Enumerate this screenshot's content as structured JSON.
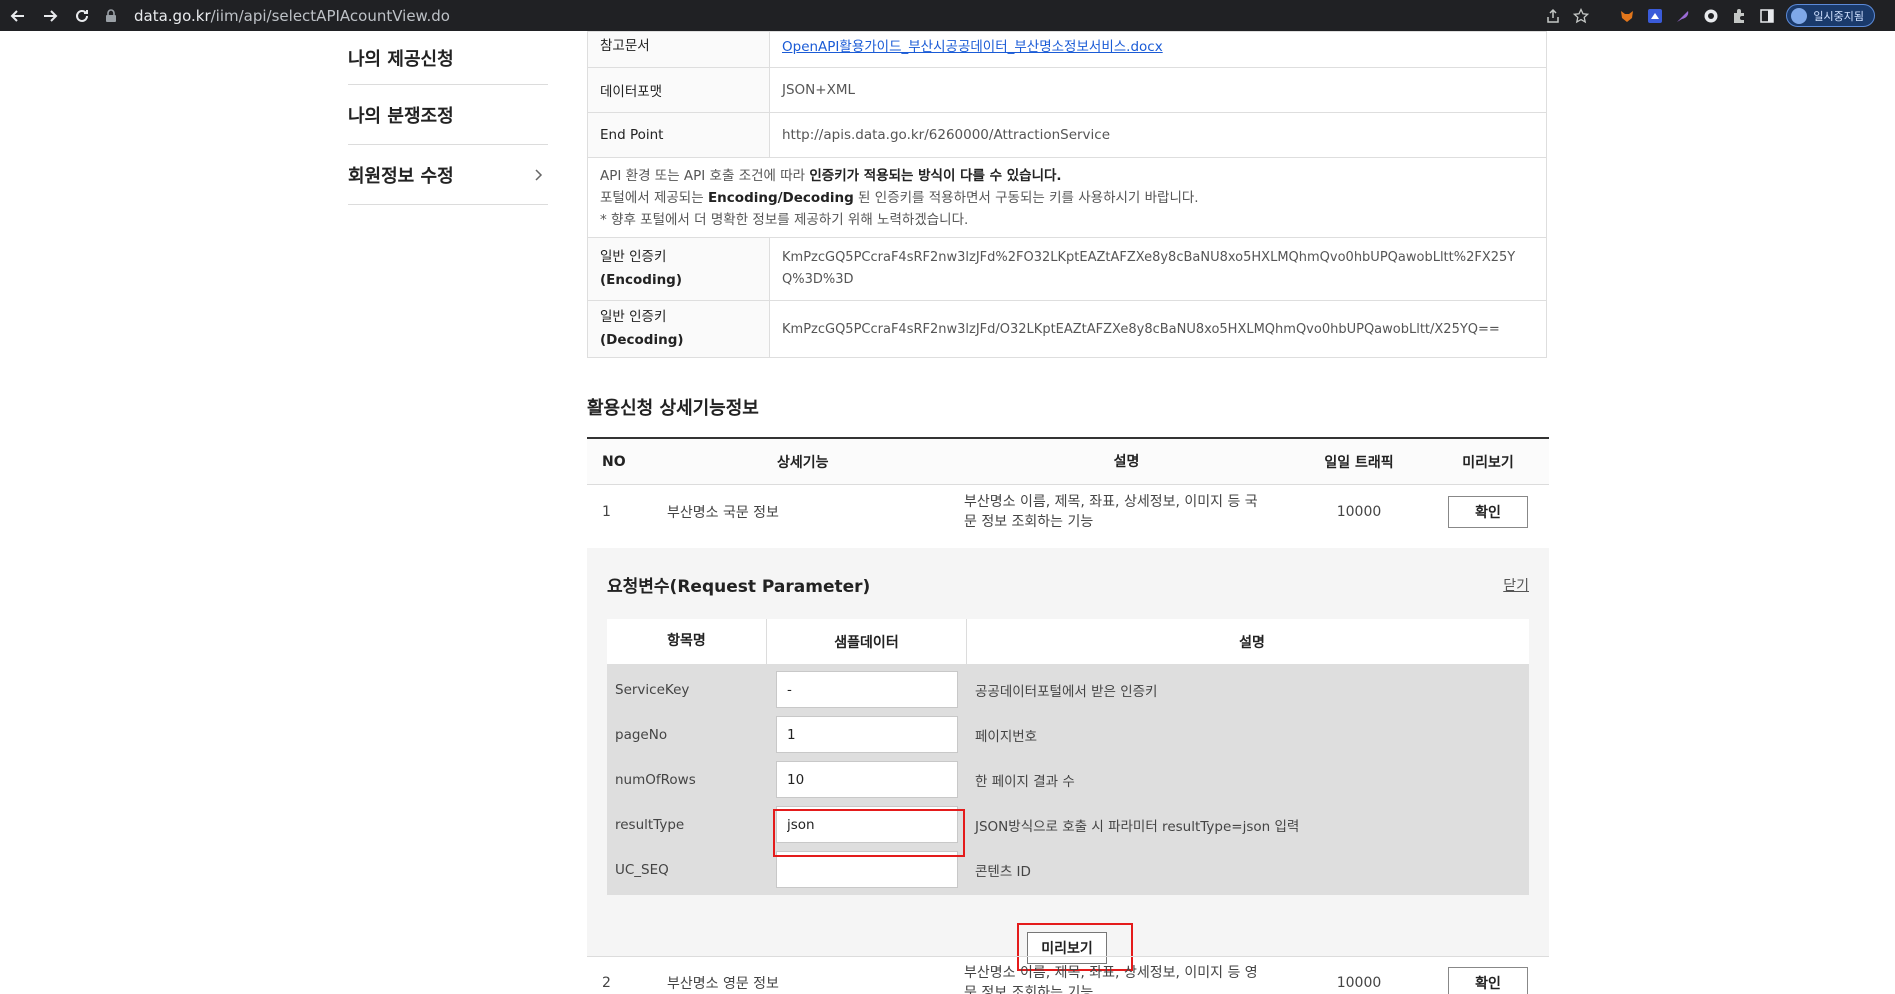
{
  "browser": {
    "url_host": "data.go.kr",
    "url_path": "/iim/api/selectAPIAcountView.do",
    "profile_label": "일시중지됨"
  },
  "sidebar": {
    "items": [
      {
        "label": "나의 제공신청"
      },
      {
        "label": "나의 분쟁조정"
      },
      {
        "label": "회원정보 수정"
      }
    ]
  },
  "info": {
    "ref_doc_label": "참고문서",
    "ref_doc_value": "OpenAPI활용가이드_부산시공공데이터_부산명소정보서비스.docx",
    "format_label": "데이터포맷",
    "format_value": "JSON+XML",
    "endpoint_label": "End Point",
    "endpoint_value": "http://apis.data.go.kr/6260000/AttractionService",
    "notice_line1_a": "API 환경 또는 API 호출 조건에 따라 ",
    "notice_line1_b": "인증키가 적용되는 방식이 다를 수 있습니다.",
    "notice_line2_a": "포털에서 제공되는 ",
    "notice_line2_b": "Encoding/Decoding",
    "notice_line2_c": " 된 인증키를 적용하면서 구동되는 키를 사용하시기 바랍니다.",
    "notice_line3": "* 향후 포털에서 더 명확한 정보를 제공하기 위해 노력하겠습니다.",
    "enc_label_1": "일반 인증키",
    "enc_label_2": "(Encoding)",
    "enc_value": "KmPzcGQ5PCcraF4sRF2nw3lzJFd%2FO32LKptEAZtAFZXe8y8cBaNU8xo5HXLMQhmQvo0hbUPQawobLltt%2FX25YQ%3D%3D",
    "dec_label_1": "일반 인증키",
    "dec_label_2": "(Decoding)",
    "dec_value": "KmPzcGQ5PCcraF4sRF2nw3lzJFd/O32LKptEAZtAFZXe8y8cBaNU8xo5HXLMQhmQvo0hbUPQawobLltt/X25YQ=="
  },
  "section_title": "활용신청 상세기능정보",
  "func_table": {
    "headers": {
      "no": "NO",
      "name": "상세기능",
      "desc": "설명",
      "traffic": "일일 트래픽",
      "preview": "미리보기"
    },
    "rows": [
      {
        "no": "1",
        "name": "부산명소 국문 정보",
        "desc_1": "부산명소 이름, 제목, 좌표, 상세정보, 이미지 등 국",
        "desc_2": "문 정보 조회하는 기능",
        "traffic": "10000",
        "button": "확인"
      },
      {
        "no": "2",
        "name": "부산명소 영문 정보",
        "desc_1": "부산명소 이름, 제목, 좌표, 상세정보, 이미지 등 영",
        "desc_2": "문 정보 조회하는 기능",
        "traffic": "10000",
        "button": "확인"
      }
    ]
  },
  "request": {
    "title": "요청변수(Request Parameter)",
    "close_label": "닫기",
    "headers": {
      "name": "항목명",
      "sample": "샘플데이터",
      "desc": "설명"
    },
    "params": [
      {
        "name": "ServiceKey",
        "value": "-",
        "desc": "공공데이터포털에서 받은 인증키"
      },
      {
        "name": "pageNo",
        "value": "1",
        "desc": "페이지번호"
      },
      {
        "name": "numOfRows",
        "value": "10",
        "desc": "한 페이지 결과 수"
      },
      {
        "name": "resultType",
        "value": "json",
        "desc": "JSON방식으로 호출 시 파라미터 resultType=json 입력"
      },
      {
        "name": "UC_SEQ",
        "value": "",
        "desc": "콘텐츠 ID"
      }
    ],
    "preview_button": "미리보기"
  },
  "colors": {
    "highlight": "#e41b1b",
    "link": "#1a5bd6"
  }
}
